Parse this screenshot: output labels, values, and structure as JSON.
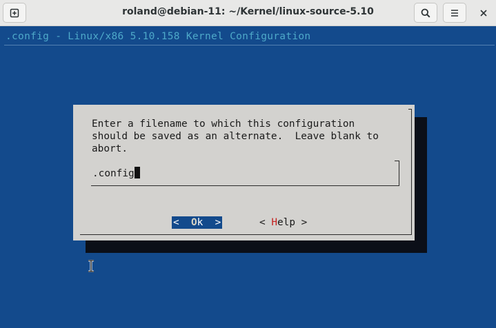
{
  "window": {
    "title": "roland@debian-11: ~/Kernel/linux-source-5.10",
    "new_tab_icon": "new-tab-icon",
    "search_icon": "search-icon",
    "menu_icon": "hamburger-menu-icon",
    "close_icon": "close-icon"
  },
  "terminal": {
    "header": ".config - Linux/x86 5.10.158 Kernel Configuration"
  },
  "dialog": {
    "prompt_lines": [
      "Enter a filename to which this configuration",
      "should be saved as an alternate.  Leave blank to",
      "abort."
    ],
    "input_value": ".config",
    "ok_button": {
      "left": "<  ",
      "hot": "O",
      "rest": "k",
      "right": "  >"
    },
    "help_button": {
      "left": "< ",
      "hot": "H",
      "rest": "elp",
      "right": " >"
    }
  },
  "colors": {
    "terminal_background": "#134a8c",
    "dialog_background": "#d3d2cf",
    "header_text": "#4ea9c9",
    "hotkey_red": "#c4201f"
  }
}
